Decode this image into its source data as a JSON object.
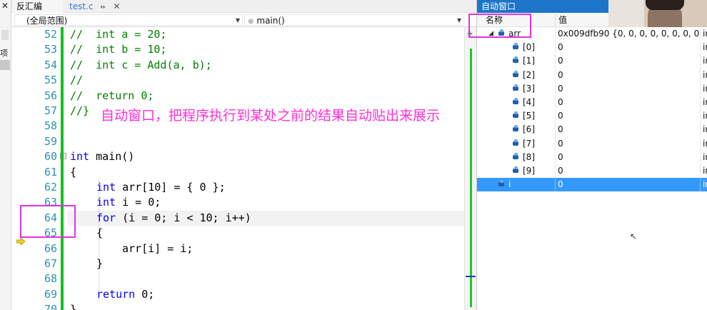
{
  "left_strip": {
    "close": "✕",
    "label": "项目"
  },
  "tabs": {
    "disassembly": "反汇编",
    "file": "test.c",
    "pin": "⇷",
    "close": "✕"
  },
  "scope": {
    "left": "(全局范围)",
    "right": "main()"
  },
  "code": {
    "line_numbers": [
      "52",
      "53",
      "54",
      "55",
      "56",
      "57",
      "58",
      "59",
      "60",
      "61",
      "62",
      "63",
      "64",
      "65",
      "66",
      "67",
      "68",
      "69",
      "70"
    ],
    "comment_lines": [
      "//  int a = 20;",
      "//  int b = 10;",
      "//  int c = Add(a, b);",
      "//",
      "//  return 0;",
      "//}"
    ],
    "main_sig_kw": "int",
    "main_sig_rest": " main()",
    "open_brace": "{",
    "decl_kw": "int",
    "decl_arr_rest": " arr[10] = { 0 };",
    "decl_i_rest": " i = 0;",
    "for_kw": "for",
    "for_rest": " (i = 0; i < 10; i++)",
    "for_open": "{",
    "assign": "arr[i] = i;",
    "for_close": "}",
    "return_kw": "return",
    "return_rest": " 0;",
    "last_brace": "}",
    "splitter_glyph": "+"
  },
  "annotation": "自动窗口，把程序执行到某处之前的结果自动贴出来展示",
  "autos": {
    "title": "自动窗口",
    "col_name": "名称",
    "col_value": "值",
    "rows": [
      {
        "name": "arr",
        "value": "0x009dfb90 {0, 0, 0, 0, 0, 0, 0, 0, 0, (",
        "type": "in",
        "expander": "◢"
      },
      {
        "name": "[0]",
        "value": "0",
        "type": "in"
      },
      {
        "name": "[1]",
        "value": "0",
        "type": "in"
      },
      {
        "name": "[2]",
        "value": "0",
        "type": "in"
      },
      {
        "name": "[3]",
        "value": "0",
        "type": "in"
      },
      {
        "name": "[4]",
        "value": "0",
        "type": "in"
      },
      {
        "name": "[5]",
        "value": "0",
        "type": "in"
      },
      {
        "name": "[6]",
        "value": "0",
        "type": "in"
      },
      {
        "name": "[7]",
        "value": "0",
        "type": "in"
      },
      {
        "name": "[8]",
        "value": "0",
        "type": "in"
      },
      {
        "name": "[9]",
        "value": "0",
        "type": "in"
      },
      {
        "name": "i",
        "value": "0",
        "type": "in"
      }
    ],
    "cursor_glyph": "↖"
  },
  "colors": {
    "accent": "#1c75c9",
    "annotation": "#ff2fd6",
    "highlight_box": "#e033e0",
    "change_bar": "#10c020",
    "selected_row": "#3399ff",
    "line_number": "#2b91af",
    "keyword": "#0000ff",
    "comment": "#008000"
  }
}
